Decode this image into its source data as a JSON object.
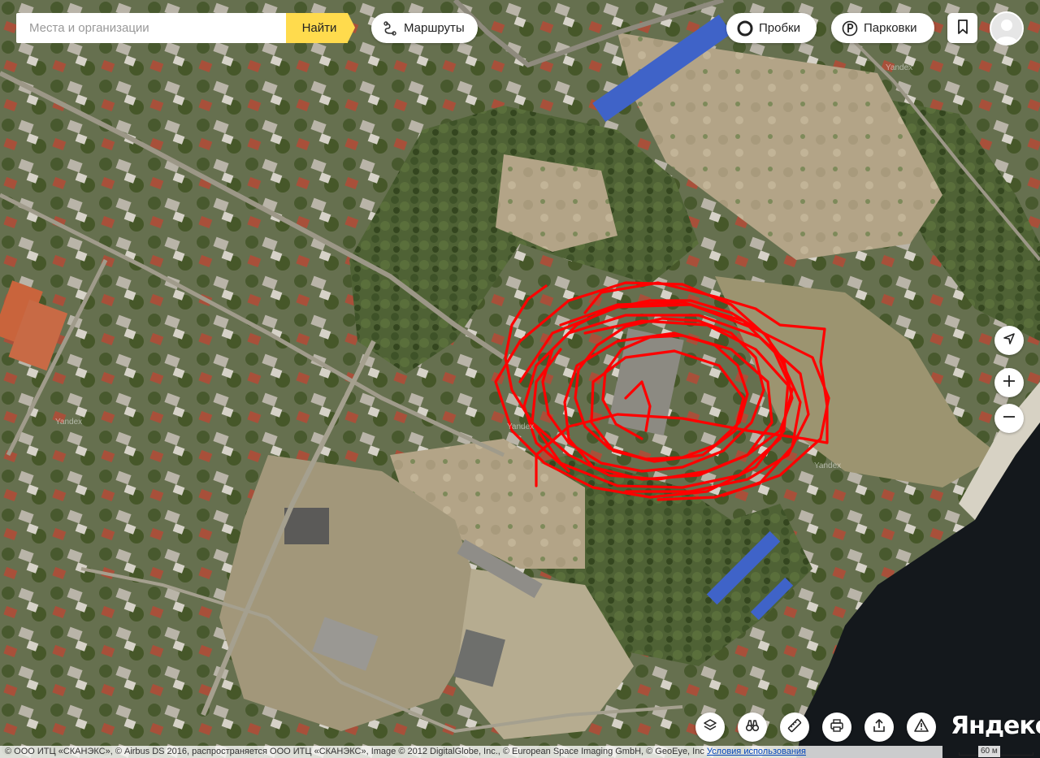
{
  "search": {
    "placeholder": "Места и организации",
    "button_label": "Найти"
  },
  "top_bar": {
    "routes_label": "Маршруты",
    "traffic_label": "Пробки",
    "parking_label": "Парковки"
  },
  "watermarks": [
    "Yandex",
    "Yandex",
    "Yandex",
    "Yandex"
  ],
  "copyright": {
    "text": "© ООО ИТЦ «СКАНЭКС», © Airbus DS 2016, распространяется ООО ИТЦ «СКАНЭКС», Image © 2012 DigitalGlobe, Inc., © European Space Imaging GmbH, © GeoEye, Inc",
    "terms_link": "Условия использования"
  },
  "scale": {
    "label": "60 м"
  },
  "logo": {
    "text": "Яндекс"
  },
  "map_layer": "satellite",
  "colors": {
    "track": "#ff0000",
    "search_button": "#ffdb4d",
    "water": "#14181c",
    "roof_blue": "#3f63c8"
  },
  "icons": {
    "routes": "route-icon",
    "traffic": "traffic-icon",
    "parking": "parking-icon",
    "bookmark": "bookmark-icon",
    "locate": "location-arrow-icon",
    "zoom_in": "plus-icon",
    "zoom_out": "minus-icon",
    "layers": "layers-icon",
    "panorama": "binoculars-icon",
    "ruler": "ruler-icon",
    "print": "printer-icon",
    "share": "share-icon",
    "error": "warning-icon"
  }
}
